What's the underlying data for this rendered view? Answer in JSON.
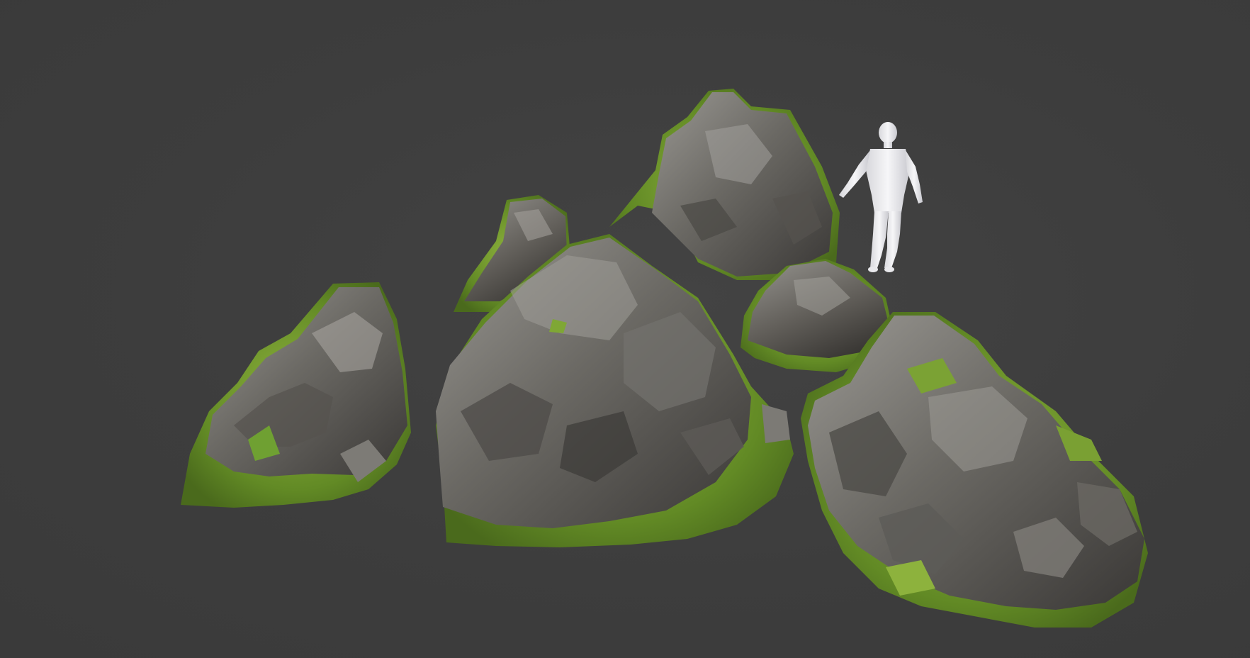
{
  "scene": {
    "background_color": "#3d3d3d",
    "rock_base_color": "#5e5c58",
    "rock_light_color": "#8d8b86",
    "rock_shadow_color": "#2f2e2c",
    "moss_color": "#6f9a2c",
    "moss_light_color": "#9dbd45",
    "figure_color": "#f1f1f3",
    "objects": [
      {
        "id": "rock-small-left",
        "kind": "rock-with-moss"
      },
      {
        "id": "rock-back-small",
        "kind": "rock-with-moss"
      },
      {
        "id": "rock-back-tall",
        "kind": "rock-with-moss"
      },
      {
        "id": "rock-large-center",
        "kind": "rock-with-moss"
      },
      {
        "id": "rock-mid-right",
        "kind": "rock-with-moss"
      },
      {
        "id": "rock-cluster-right",
        "kind": "rock-with-moss"
      },
      {
        "id": "scale-reference-figure",
        "kind": "humanoid-mannequin"
      }
    ]
  }
}
